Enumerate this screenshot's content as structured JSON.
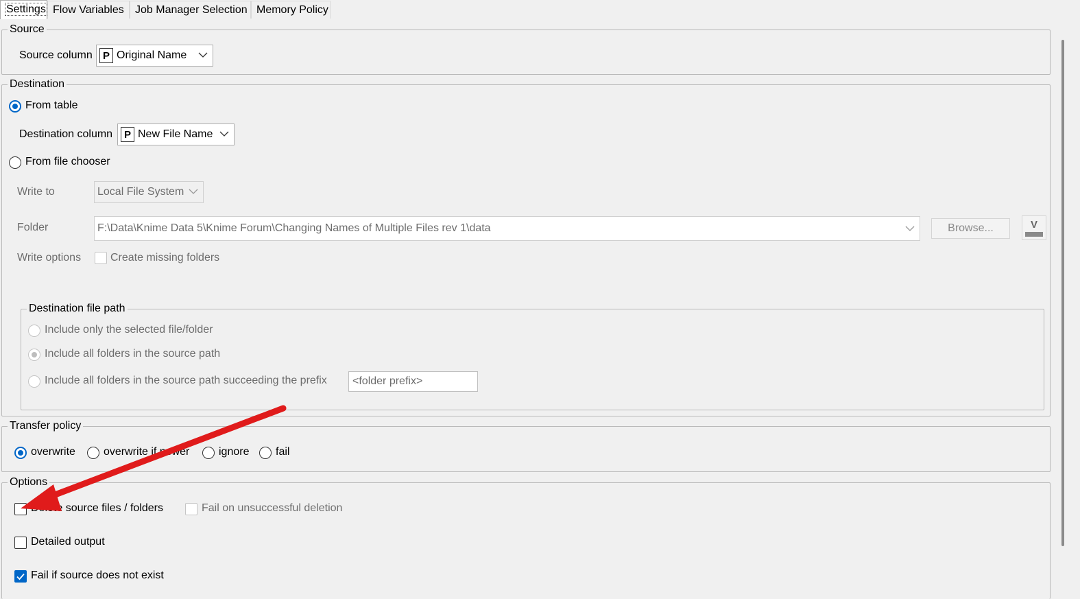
{
  "tabs": [
    {
      "label": "Settings",
      "active": true
    },
    {
      "label": "Flow Variables"
    },
    {
      "label": "Job Manager Selection"
    },
    {
      "label": "Memory Policy"
    }
  ],
  "source": {
    "title": "Source",
    "column_label": "Source column",
    "column_type_icon": "P",
    "column_value": "Original Name"
  },
  "destination": {
    "title": "Destination",
    "from_table_label": "From table",
    "from_table_selected": true,
    "column_label": "Destination column",
    "column_type_icon": "P",
    "column_value": "New File Name",
    "from_file_chooser_label": "From file chooser",
    "write_to_label": "Write to",
    "write_to_value": "Local File System",
    "folder_label": "Folder",
    "folder_value": "F:\\Data\\Knime Data 5\\Knime Forum\\Changing Names of Multiple Files rev 1\\data",
    "browse_label": "Browse...",
    "flow_variable_icon": "V",
    "write_options_label": "Write options",
    "create_missing_folders_label": "Create missing folders",
    "file_path": {
      "title": "Destination file path",
      "option_selected_only": "Include only the selected file/folder",
      "option_all_folders": "Include all folders in the source path",
      "option_succeeding_prefix": "Include all folders in the source path succeeding the prefix",
      "prefix_placeholder": "<folder prefix>",
      "selected": "all_folders"
    }
  },
  "transfer_policy": {
    "title": "Transfer policy",
    "options": [
      "overwrite",
      "overwrite if newer",
      "ignore",
      "fail"
    ],
    "selected": "overwrite"
  },
  "options": {
    "title": "Options",
    "delete_source_label": "Delete source files / folders",
    "delete_source_checked": false,
    "fail_on_deletion_label": "Fail on unsuccessful deletion",
    "detailed_output_label": "Detailed output",
    "detailed_output_checked": false,
    "fail_if_not_exist_label": "Fail if source does not exist",
    "fail_if_not_exist_checked": true
  },
  "annotation": {
    "arrow_color": "#e01b1b",
    "arrow_target": "delete-source-checkbox"
  }
}
